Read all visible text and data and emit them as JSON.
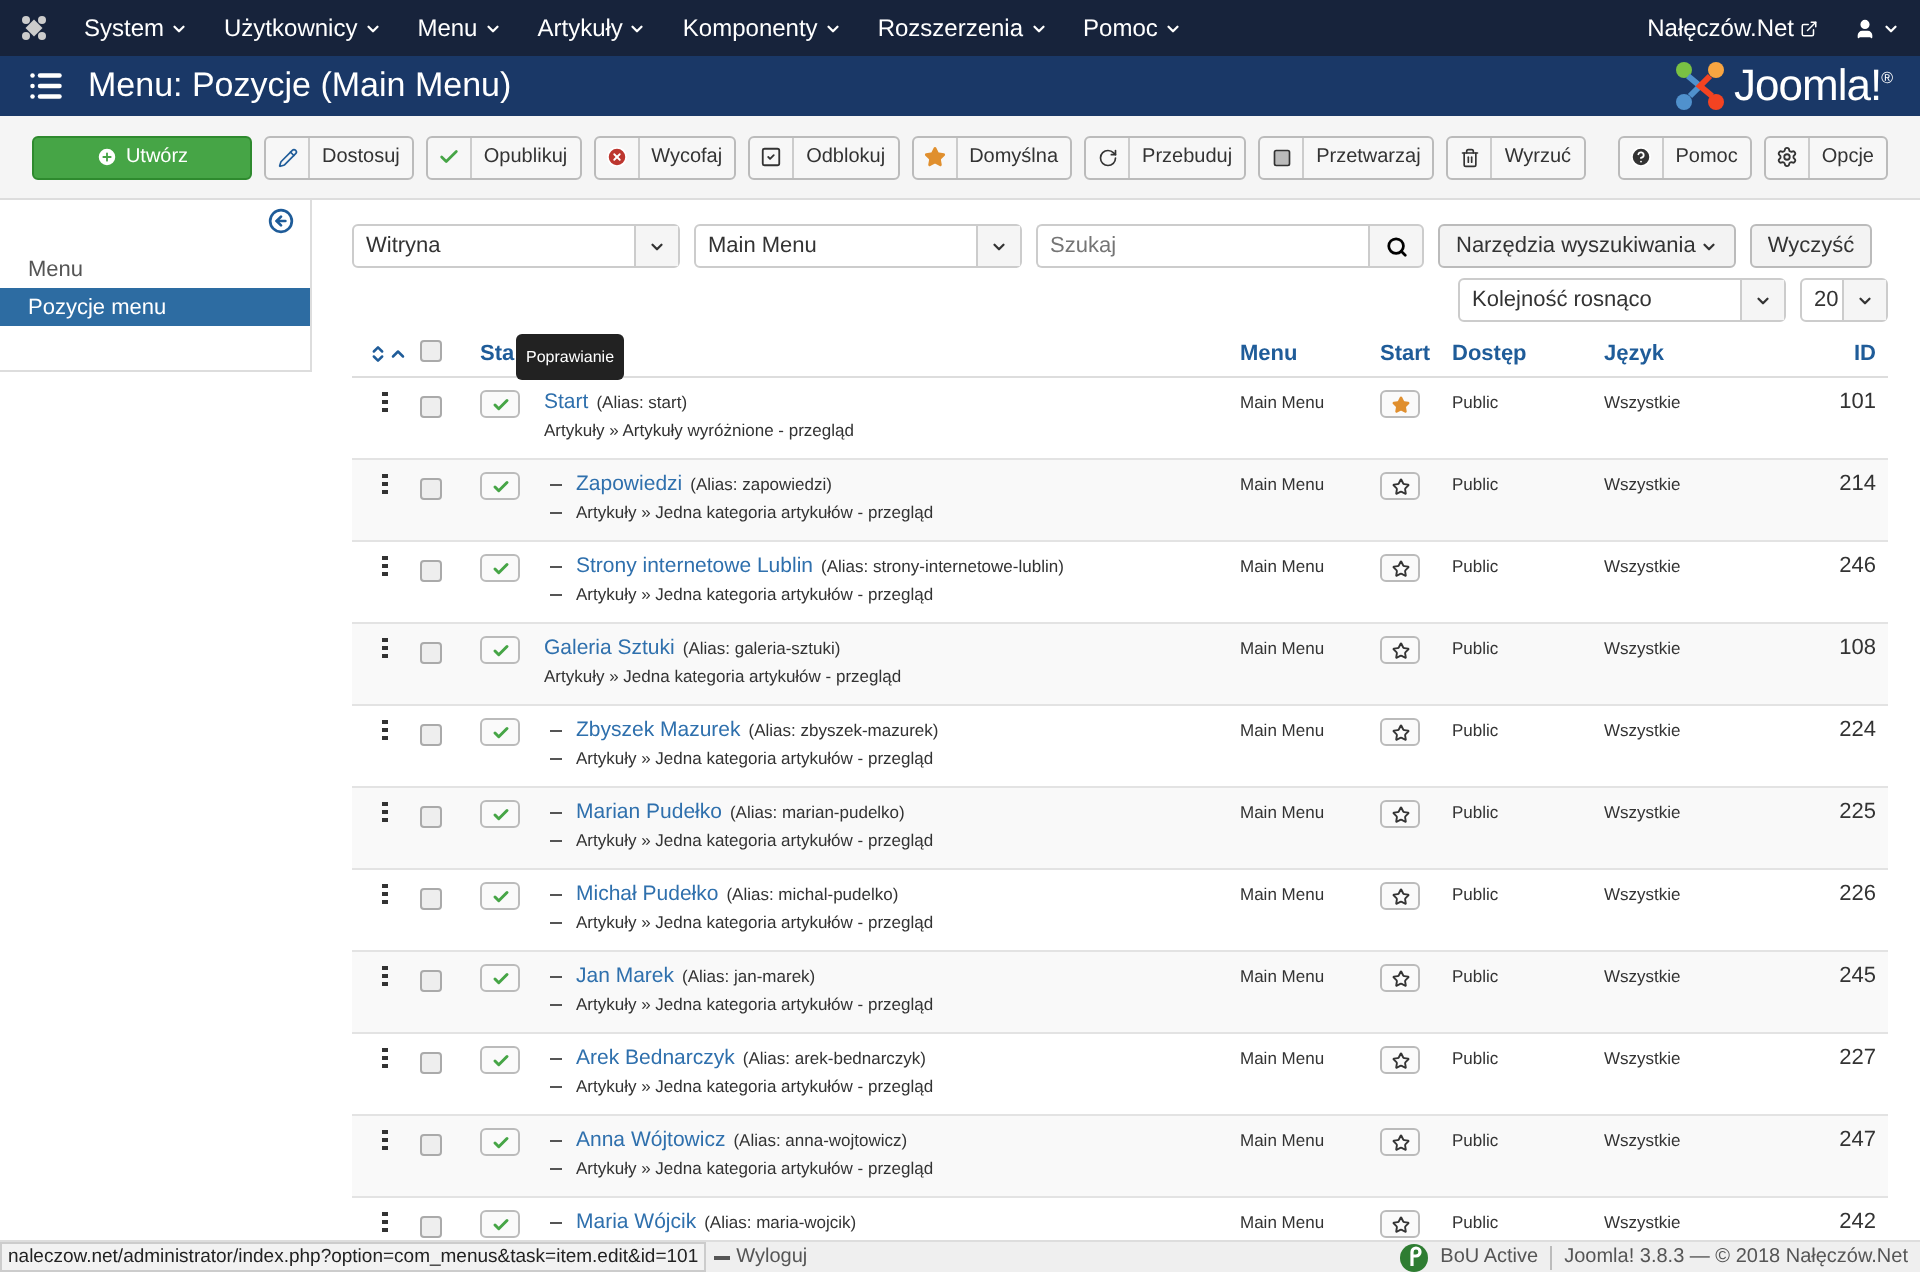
{
  "topnav": {
    "menus": [
      "System",
      "Użytkownicy",
      "Menu",
      "Artykuły",
      "Komponenty",
      "Rozszerzenia",
      "Pomoc"
    ],
    "site": "Nałęczów.Net"
  },
  "header": {
    "title": "Menu: Pozycje (Main Menu)",
    "logo": "Joomla!$^{®}$"
  },
  "toolbar": [
    {
      "label": "Utwórz",
      "kind": "new"
    },
    {
      "label": "Dostosuj",
      "kind": "edit"
    },
    {
      "label": "Opublikuj",
      "kind": "publish"
    },
    {
      "label": "Wycofaj",
      "kind": "unpublish"
    },
    {
      "label": "Odblokuj",
      "kind": "checkin"
    },
    {
      "label": "Domyślna",
      "kind": "default"
    },
    {
      "label": "Przebuduj",
      "kind": "rebuild"
    },
    {
      "label": "Przetwarzaj",
      "kind": "batch"
    },
    {
      "label": "Wyrzuć",
      "kind": "trash"
    }
  ],
  "toolbar_right": [
    {
      "label": "Pomoc",
      "kind": "help"
    },
    {
      "label": "Opcje",
      "kind": "options"
    }
  ],
  "sidebar": {
    "items": [
      {
        "label": "Menu",
        "selected": false
      },
      {
        "label": "Pozycje menu",
        "selected": true
      }
    ]
  },
  "filters": {
    "site": "Witryna",
    "menu": "Main Menu",
    "search_placeholder": "Szukaj",
    "tools": "Narzędzia wyszukiwania",
    "clear": "Wyczyść",
    "ordering": "Kolejność rosnąco",
    "limit": "20"
  },
  "tooltip": "Poprawianie",
  "table": {
    "select_all_checked": false,
    "columns": {
      "status": "Sta",
      "menu": "Menu",
      "home": "Start",
      "access": "Dostęp",
      "language": "Język",
      "id": "ID"
    },
    "rows": [
      {
        "title": "Start",
        "alias": "(Alias: start)",
        "type": "Artykuły » Artykuły wyróżnione - przegląd",
        "menu": "Main Menu",
        "access": "Public",
        "language": "Wszystkie",
        "id": "101",
        "checked": false,
        "published": true,
        "home": true,
        "children": [
          {
            "title": "Zapowiedzi",
            "alias": "(Alias: zapowiedzi)",
            "type": "Artykuły » Jedna kategoria artykułów - przegląd",
            "menu": "Main Menu",
            "access": "Public",
            "language": "Wszystkie",
            "id": "214",
            "checked": false,
            "published": true,
            "home": false
          },
          {
            "title": "Strony internetowe Lublin",
            "alias": "(Alias: strony-internetowe-lublin)",
            "type": "Artykuły » Jedna kategoria artykułów - przegląd",
            "menu": "Main Menu",
            "access": "Public",
            "language": "Wszystkie",
            "id": "246",
            "checked": false,
            "published": true,
            "home": false
          }
        ]
      },
      {
        "title": "Galeria Sztuki",
        "alias": "(Alias: galeria-sztuki)",
        "type": "Artykuły » Jedna kategoria artykułów - przegląd",
        "menu": "Main Menu",
        "access": "Public",
        "language": "Wszystkie",
        "id": "108",
        "checked": false,
        "published": true,
        "home": false,
        "children": [
          {
            "title": "Zbyszek Mazurek",
            "alias": "(Alias: zbyszek-mazurek)",
            "type": "Artykuły » Jedna kategoria artykułów - przegląd",
            "menu": "Main Menu",
            "access": "Public",
            "language": "Wszystkie",
            "id": "224",
            "checked": false,
            "published": true,
            "home": false
          },
          {
            "title": "Marian Pudełko",
            "alias": "(Alias: marian-pudelko)",
            "type": "Artykuły » Jedna kategoria artykułów - przegląd",
            "menu": "Main Menu",
            "access": "Public",
            "language": "Wszystkie",
            "id": "225",
            "checked": false,
            "published": true,
            "home": false
          },
          {
            "title": "Michał Pudełko",
            "alias": "(Alias: michal-pudelko)",
            "type": "Artykuły » Jedna kategoria artykułów - przegląd",
            "menu": "Main Menu",
            "access": "Public",
            "language": "Wszystkie",
            "id": "226",
            "checked": false,
            "published": true,
            "home": false
          },
          {
            "title": "Jan Marek",
            "alias": "(Alias: jan-marek)",
            "type": "Artykuły » Jedna kategoria artykułów - przegląd",
            "menu": "Main Menu",
            "access": "Public",
            "language": "Wszystkie",
            "id": "245",
            "checked": false,
            "published": true,
            "home": false
          },
          {
            "title": "Arek Bednarczyk",
            "alias": "(Alias: arek-bednarczyk)",
            "type": "Artykuły » Jedna kategoria artykułów - przegląd",
            "menu": "Main Menu",
            "access": "Public",
            "language": "Wszystkie",
            "id": "227",
            "checked": false,
            "published": true,
            "home": false
          },
          {
            "title": "Anna Wójtowicz",
            "alias": "(Alias: anna-wojtowicz)",
            "type": "Artykuły » Jedna kategoria artykułów - przegląd",
            "menu": "Main Menu",
            "access": "Public",
            "language": "Wszystkie",
            "id": "247",
            "checked": false,
            "published": true,
            "home": false
          },
          {
            "title": "Maria Wójcik",
            "alias": "(Alias: maria-wojcik)",
            "menu": "Main Menu",
            "access": "Public",
            "language": "Wszystkie",
            "id": "242",
            "checked": false,
            "published": true,
            "home": false
          }
        ]
      }
    ]
  },
  "status_bar": {
    "url": "naleczow.net/administrator/index.php?option=com_menus&task=item.edit&id=101",
    "logout": "Wyloguj",
    "plugin": "BoU Active",
    "version": "Joomla! 3.8.3 — © 2018 Nałęczów.Net"
  }
}
